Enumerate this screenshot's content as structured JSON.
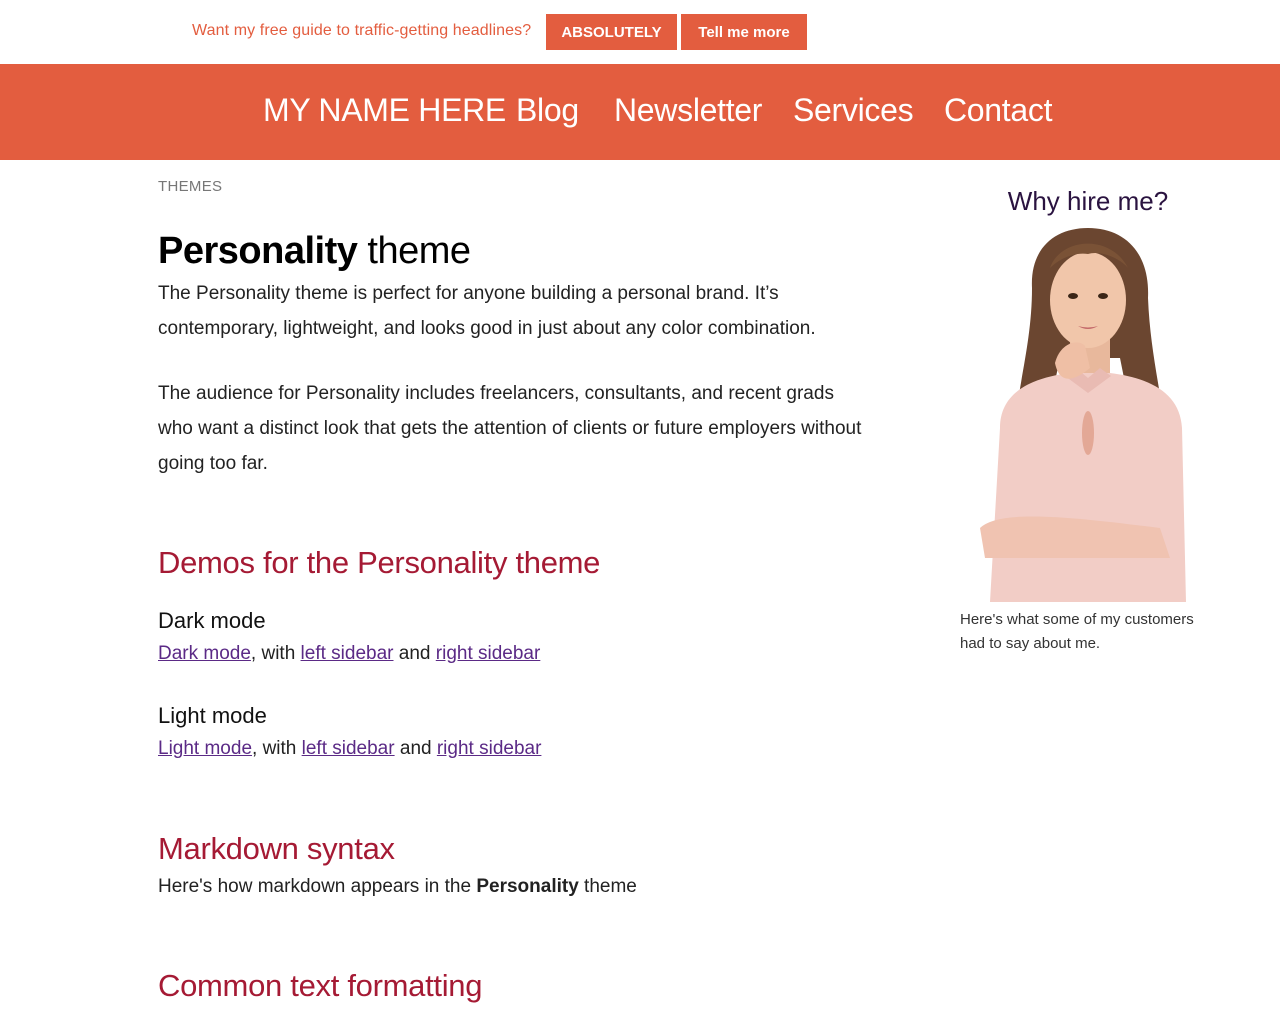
{
  "promo": {
    "text": "Want my free guide to traffic-getting headlines?",
    "primary_button": "ABSOLUTELY",
    "secondary_button": "Tell me more"
  },
  "nav": {
    "brand": "MY NAME HERE",
    "items": [
      "Blog",
      "Newsletter",
      "Services",
      "Contact"
    ]
  },
  "main": {
    "eyebrow": "THEMES",
    "title_strong": "Personality",
    "title_rest": " theme",
    "para1": "The Personality theme is perfect for anyone building a personal brand. It’s contemporary, lightweight, and looks good in just about any color combination.",
    "para2": "The audience for Personality includes freelancers, consultants, and recent grads who want a distinct look that gets the attention of clients or future employers without going too far.",
    "demos_heading": "Demos for the Personality theme",
    "dark": {
      "heading": "Dark mode",
      "link_main": "Dark mode",
      "with": ", with ",
      "link_left": "left sidebar",
      "and": " and ",
      "link_right": "right sidebar"
    },
    "light": {
      "heading": "Light mode",
      "link_main": "Light mode",
      "with": ", with ",
      "link_left": "left sidebar",
      "and": " and ",
      "link_right": "right sidebar"
    },
    "markdown_heading": "Markdown syntax",
    "markdown_pre": "Here's how markdown appears in the ",
    "markdown_strong": "Personality",
    "markdown_post": " theme",
    "common_heading": "Common text formatting"
  },
  "sidebar": {
    "title": "Why hire me?",
    "caption": "Here's what some of my customers had to say about me."
  },
  "colors": {
    "accent": "#e35d3f",
    "heading": "#a51a34",
    "link": "#5b2a86",
    "sidebar_title": "#2a1340"
  }
}
